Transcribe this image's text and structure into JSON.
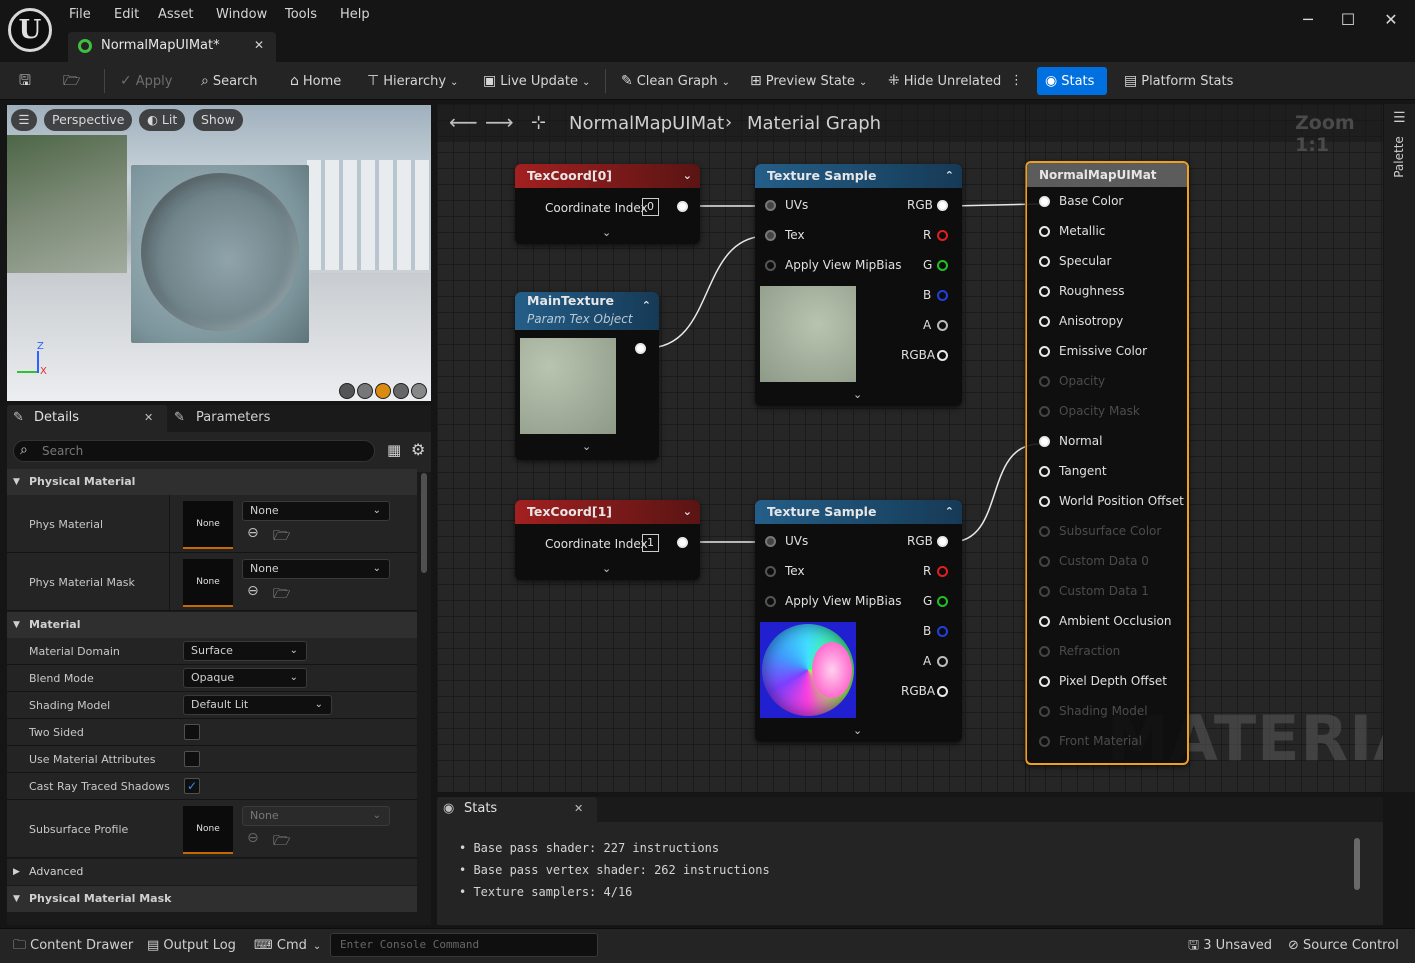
{
  "app": {
    "logo": "U",
    "menu": [
      "File",
      "Edit",
      "Asset",
      "Window",
      "Tools",
      "Help"
    ],
    "doc_tab": "NormalMapUIMat*",
    "win_min": "─",
    "win_max": "☐",
    "win_close": "✕"
  },
  "toolbar": {
    "apply": "Apply",
    "search": "Search",
    "home": "Home",
    "hierarchy": "Hierarchy",
    "live_update": "Live Update",
    "clean_graph": "Clean Graph",
    "preview_state": "Preview State",
    "hide_unrelated": "Hide Unrelated",
    "stats": "Stats",
    "platform_stats": "Platform Stats"
  },
  "viewport": {
    "perspective": "Perspective",
    "lit": "Lit",
    "show": "Show",
    "axis_z": "Z",
    "axis_x": "X"
  },
  "details": {
    "tab_details": "Details",
    "tab_parameters": "Parameters",
    "search_placeholder": "Search",
    "sec_physical": "Physical Material",
    "phys_material": "Phys Material",
    "phys_material_mask": "Phys Material Mask",
    "none": "None",
    "sec_material": "Material",
    "material_domain": "Material Domain",
    "material_domain_val": "Surface",
    "blend_mode": "Blend Mode",
    "blend_mode_val": "Opaque",
    "shading_model": "Shading Model",
    "shading_model_val": "Default Lit",
    "two_sided": "Two Sided",
    "two_sided_checked": false,
    "use_material_attributes": "Use Material Attributes",
    "use_material_attributes_checked": false,
    "cast_ray_traced_shadows": "Cast Ray Traced Shadows",
    "cast_ray_traced_shadows_checked": true,
    "subsurface_profile": "Subsurface Profile",
    "sec_advanced": "Advanced",
    "sec_physical_mask": "Physical Material Mask"
  },
  "graph": {
    "breadcrumb_root": "NormalMapUIMat",
    "breadcrumb_sep": "›",
    "breadcrumb_leaf": "Material Graph",
    "zoom": "Zoom 1:1",
    "palette": "Palette",
    "watermark": "MATERIAL",
    "texcoord0": {
      "title": "TexCoord[0]",
      "label": "Coordinate Index",
      "index": "0"
    },
    "texcoord1": {
      "title": "TexCoord[1]",
      "label": "Coordinate Index",
      "index": "1"
    },
    "maintexture": {
      "title": "MainTexture",
      "subtitle": "Param Tex Object"
    },
    "texsample": {
      "title": "Texture Sample",
      "uvs": "UVs",
      "tex": "Tex",
      "mipbias": "Apply View MipBias",
      "rgb": "RGB",
      "r": "R",
      "g": "G",
      "b": "B",
      "a": "A",
      "rgba": "RGBA"
    },
    "result": {
      "title": "NormalMapUIMat",
      "pins": [
        {
          "label": "Base Color",
          "active": true,
          "connected": true
        },
        {
          "label": "Metallic",
          "active": true,
          "connected": false
        },
        {
          "label": "Specular",
          "active": true,
          "connected": false
        },
        {
          "label": "Roughness",
          "active": true,
          "connected": false
        },
        {
          "label": "Anisotropy",
          "active": true,
          "connected": false
        },
        {
          "label": "Emissive Color",
          "active": true,
          "connected": false
        },
        {
          "label": "Opacity",
          "active": false,
          "connected": false
        },
        {
          "label": "Opacity Mask",
          "active": false,
          "connected": false
        },
        {
          "label": "Normal",
          "active": true,
          "connected": true
        },
        {
          "label": "Tangent",
          "active": true,
          "connected": false
        },
        {
          "label": "World Position Offset",
          "active": true,
          "connected": false
        },
        {
          "label": "Subsurface Color",
          "active": false,
          "connected": false
        },
        {
          "label": "Custom Data 0",
          "active": false,
          "connected": false
        },
        {
          "label": "Custom Data 1",
          "active": false,
          "connected": false
        },
        {
          "label": "Ambient Occlusion",
          "active": true,
          "connected": false
        },
        {
          "label": "Refraction",
          "active": false,
          "connected": false
        },
        {
          "label": "Pixel Depth Offset",
          "active": true,
          "connected": false
        },
        {
          "label": "Shading Model",
          "active": false,
          "connected": false
        },
        {
          "label": "Front Material",
          "active": false,
          "connected": false
        }
      ]
    }
  },
  "stats": {
    "tab": "Stats",
    "lines": [
      "Base pass shader: 227 instructions",
      "Base pass vertex shader: 262 instructions",
      "Texture samplers: 4/16"
    ]
  },
  "statusbar": {
    "content_drawer": "Content Drawer",
    "output_log": "Output Log",
    "cmd": "Cmd",
    "console_placeholder": "Enter Console Command",
    "unsaved": "3 Unsaved",
    "source_control": "Source Control"
  },
  "colors": {
    "accent": "#0070e0",
    "node_orange": "#f0a020",
    "texcoord_head": "#8a1a1a",
    "texsample_head": "#1e4e72",
    "red": "#e02020",
    "green": "#20c020",
    "blue": "#2040e0"
  }
}
